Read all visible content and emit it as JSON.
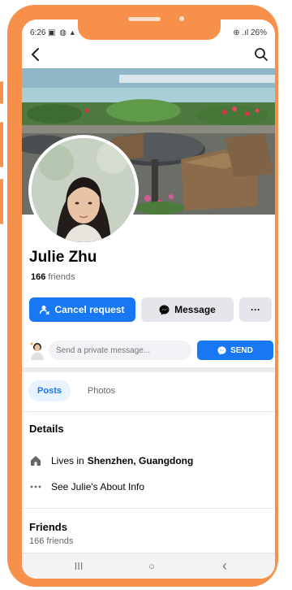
{
  "status_bar": {
    "time": "6:26",
    "left_icons": "▣ ◍ ▴",
    "right_text": "⊕ .ıl 26%"
  },
  "profile": {
    "name": "Julie Zhu",
    "friend_count": "166",
    "friends_label": "friends"
  },
  "actions": {
    "cancel_request_label": "Cancel request",
    "message_label": "Message",
    "more_label": "···"
  },
  "private_message": {
    "placeholder": "Send a private message...",
    "send_label": "SEND"
  },
  "tabs": [
    {
      "label": "Posts",
      "active": true
    },
    {
      "label": "Photos",
      "active": false
    }
  ],
  "details": {
    "title": "Details",
    "lives_in_prefix": "Lives in",
    "lives_in_place": "Shenzhen, Guangdong",
    "about_link": "See Julie's About Info"
  },
  "friends_section": {
    "title": "Friends",
    "count_text": "166 friends"
  },
  "navbar": {
    "recents": "III",
    "home": "○",
    "back": "‹"
  },
  "colors": {
    "accent": "#1877f2",
    "frame": "#f6904a",
    "secondary_button": "#e4e6eb"
  }
}
